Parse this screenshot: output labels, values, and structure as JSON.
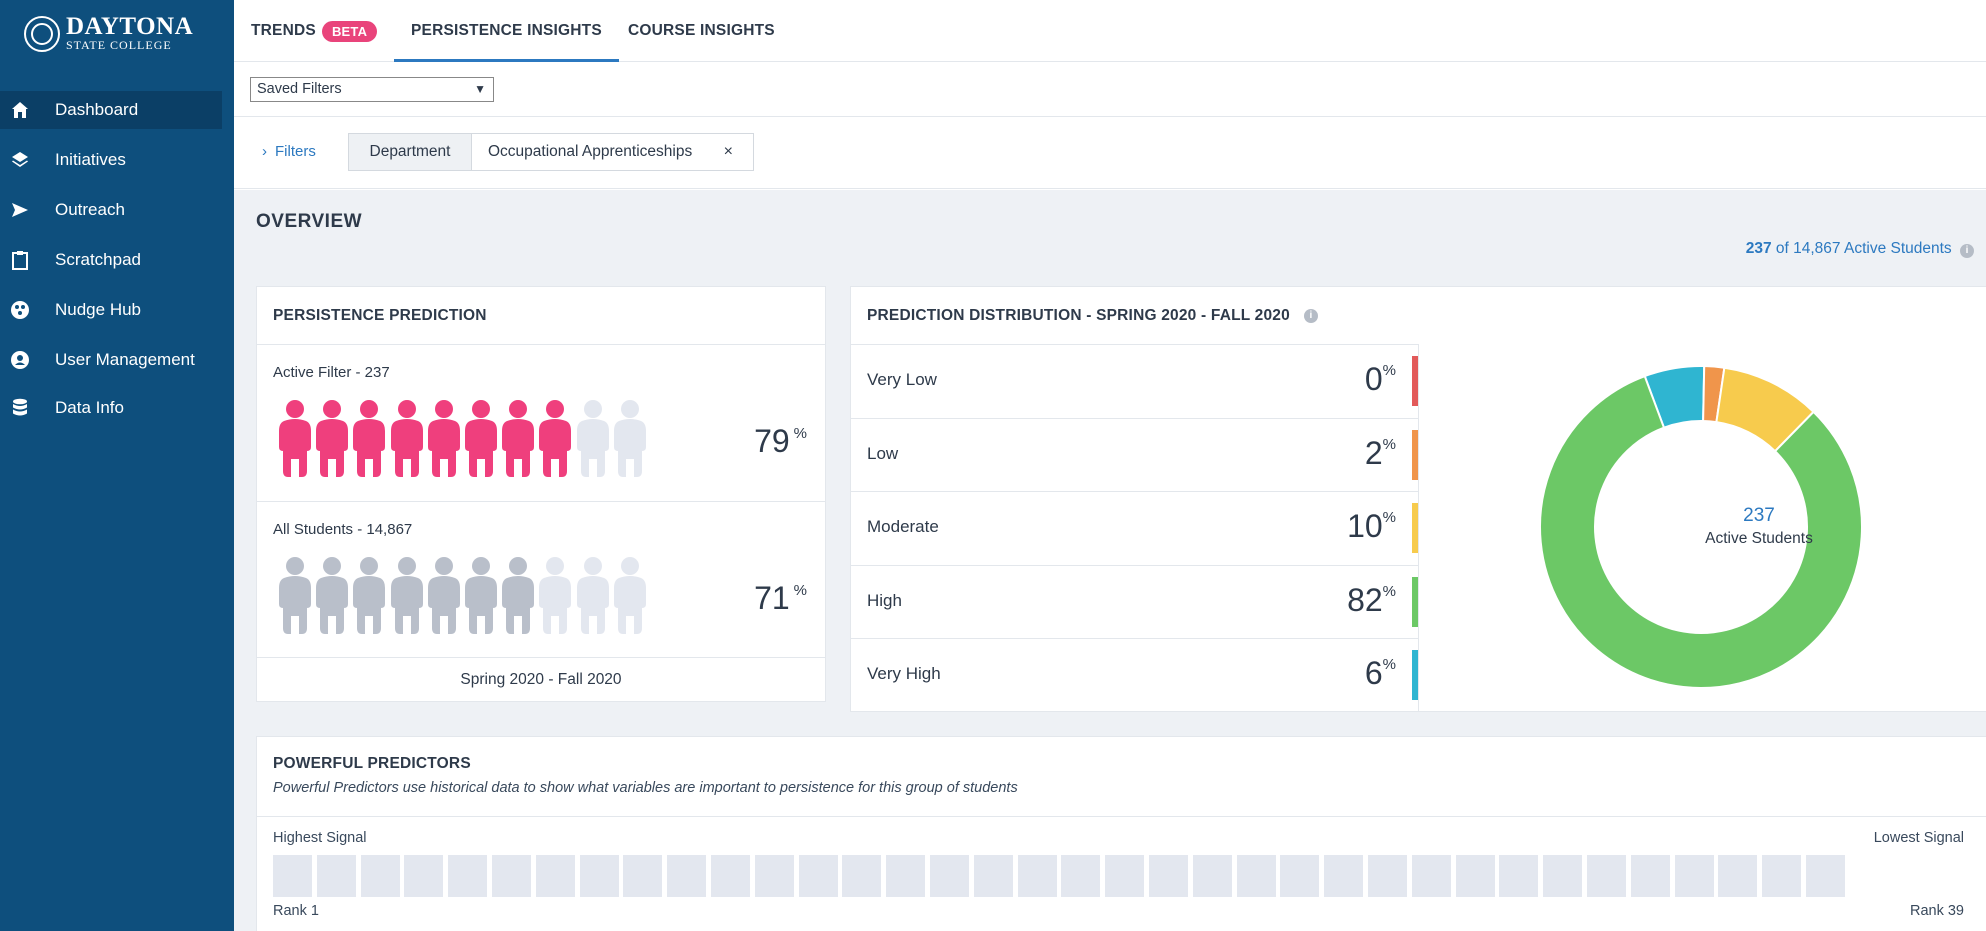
{
  "brand": {
    "name": "DAYTONA",
    "sub": "STATE COLLEGE"
  },
  "sidebar": {
    "items": [
      {
        "label": "Dashboard",
        "icon": "home-icon",
        "active": true
      },
      {
        "label": "Initiatives",
        "icon": "layers-icon"
      },
      {
        "label": "Outreach",
        "icon": "send-icon"
      },
      {
        "label": "Scratchpad",
        "icon": "clipboard-icon"
      },
      {
        "label": "Nudge Hub",
        "icon": "nudge-icon"
      },
      {
        "label": "User Management",
        "icon": "user-management-icon"
      },
      {
        "label": "Data Info",
        "icon": "database-icon"
      }
    ]
  },
  "tabs": [
    {
      "label": "TRENDS",
      "badge": "BETA"
    },
    {
      "label": "PERSISTENCE INSIGHTS",
      "active": true
    },
    {
      "label": "COURSE INSIGHTS"
    }
  ],
  "saved_filters": {
    "label": "Saved Filters",
    "caret": "▼"
  },
  "filters": {
    "link": "Filters",
    "chevron": "›",
    "chip_key": "Department",
    "chip_value": "Occupational Apprenticeships",
    "remove": "×"
  },
  "overview": {
    "title": "OVERVIEW",
    "active_count": "237",
    "active_total_text": "of 14,867 Active Students"
  },
  "persistence": {
    "title": "PERSISTENCE PREDICTION",
    "active": {
      "label": "Active Filter - 237",
      "pct": "79",
      "filled": 8,
      "total": 10
    },
    "all": {
      "label": "All Students - 14,867",
      "pct": "71",
      "filled": 7,
      "total": 10
    },
    "footer": "Spring 2020 - Fall 2020",
    "pct_unit": "%"
  },
  "distribution": {
    "title": "PREDICTION DISTRIBUTION - SPRING 2020 - FALL 2020",
    "info": "i",
    "rows": [
      {
        "label": "Very Low",
        "value": "0",
        "color": "#e25a5a"
      },
      {
        "label": "Low",
        "value": "2",
        "color": "#f0954b"
      },
      {
        "label": "Moderate",
        "value": "10",
        "color": "#f7cb4d"
      },
      {
        "label": "High",
        "value": "82",
        "color": "#6cc866"
      },
      {
        "label": "Very High",
        "value": "6",
        "color": "#2fb5d1"
      }
    ],
    "unit": "%",
    "donut_center_value": "237",
    "donut_center_label": "Active Students"
  },
  "predictors": {
    "title": "POWERFUL PREDICTORS",
    "subtitle": "Powerful Predictors use historical data to show what variables are important to persistence for this group of students",
    "highest": "Highest Signal",
    "lowest": "Lowest Signal",
    "rank_first": "Rank 1",
    "rank_last": "Rank 39",
    "count": 36
  },
  "colors": {
    "sidebar": "#0e4f7d",
    "accent": "#2c79c0",
    "pink": "#ef3f7d",
    "person_gray": "#b9bfca",
    "person_empty": "#e3e7ef"
  }
}
